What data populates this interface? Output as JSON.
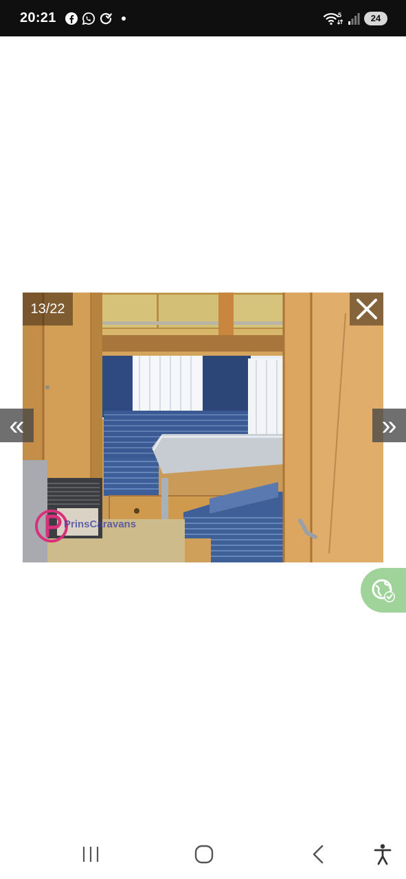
{
  "status_bar": {
    "time": "20:21",
    "app_icons": [
      "facebook-icon",
      "whatsapp-icon",
      "sync-app-icon"
    ],
    "wifi_badge": "5",
    "battery_level": "24"
  },
  "gallery": {
    "counter": "13/22",
    "prev_glyph": "«",
    "next_glyph": "»",
    "watermark_text": "PrinsCaravans"
  },
  "nav_bar": {
    "buttons": [
      "recent-apps",
      "home",
      "back",
      "accessibility"
    ]
  },
  "colors": {
    "translate_fab": "#9fd39a",
    "watermark_accent": "#d8307a",
    "status_bar": "#0f0f0f"
  }
}
